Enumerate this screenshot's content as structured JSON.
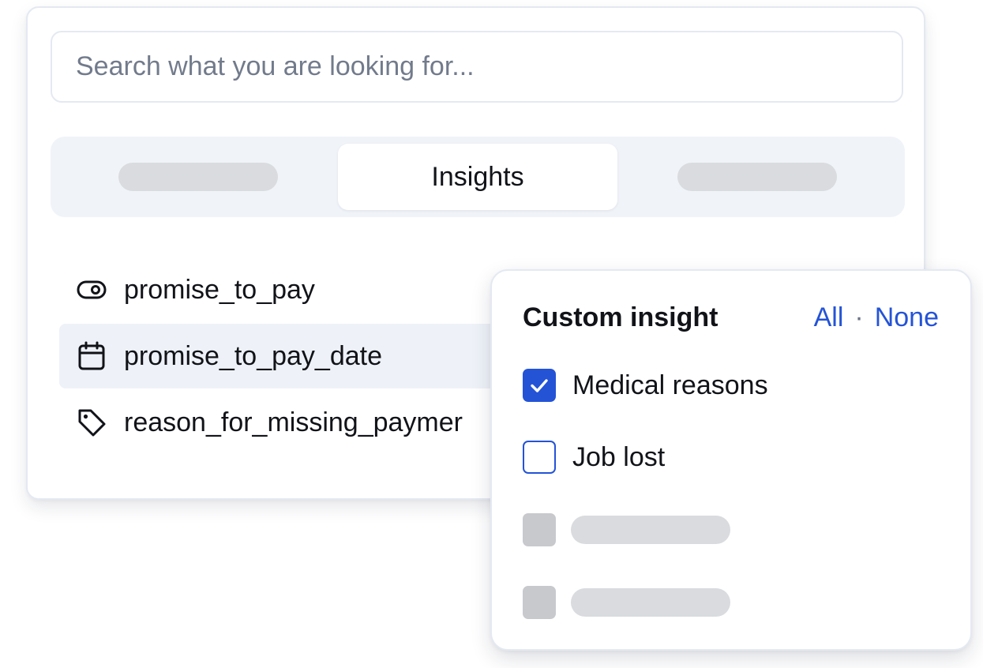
{
  "search": {
    "placeholder": "Search what you are looking for..."
  },
  "tabs": {
    "active_label": "Insights"
  },
  "fields": [
    {
      "label": "promise_to_pay",
      "icon": "toggle-icon"
    },
    {
      "label": "promise_to_pay_date",
      "icon": "calendar-icon",
      "selected": true
    },
    {
      "label": "reason_for_missing_paymer",
      "icon": "tag-icon"
    }
  ],
  "popover": {
    "title": "Custom insight",
    "all_label": "All",
    "separator": "·",
    "none_label": "None",
    "options": [
      {
        "label": "Medical reasons",
        "checked": true
      },
      {
        "label": "Job lost",
        "checked": false
      }
    ]
  },
  "colors": {
    "accent": "#2453d6",
    "skeleton": "#d9dbde",
    "tab_bg": "#f0f3f8"
  }
}
